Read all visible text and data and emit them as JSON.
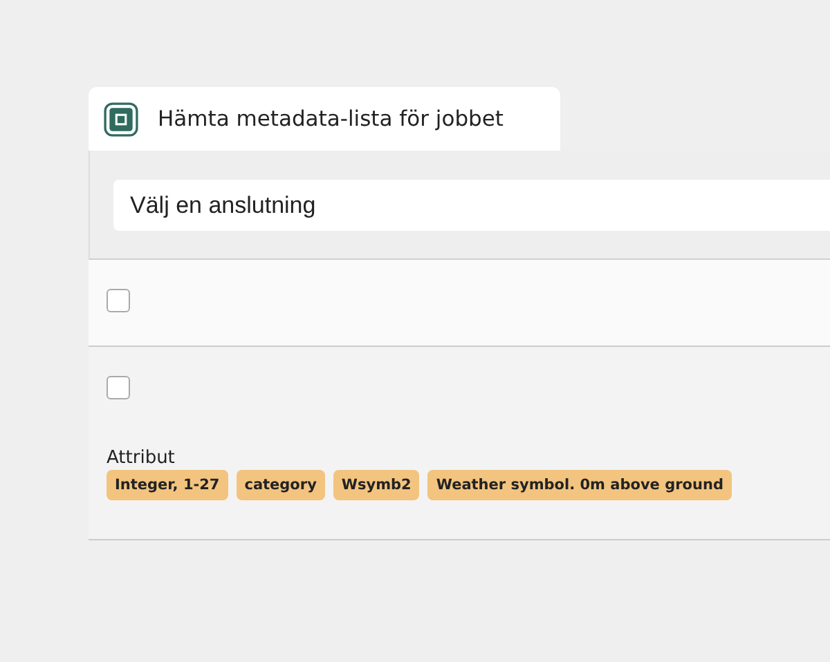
{
  "tab": {
    "title": "Hämta metadata-lista för jobbet",
    "selected": true
  },
  "connection": {
    "placeholder": "Välj en anslutning"
  },
  "rows": [
    {
      "checked": false
    },
    {
      "checked": false,
      "attribute": {
        "label": "Attribut",
        "tags": [
          "Integer, 1-27",
          "category",
          "Wsymb2",
          "Weather symbol. 0m above ground"
        ]
      }
    }
  ]
}
